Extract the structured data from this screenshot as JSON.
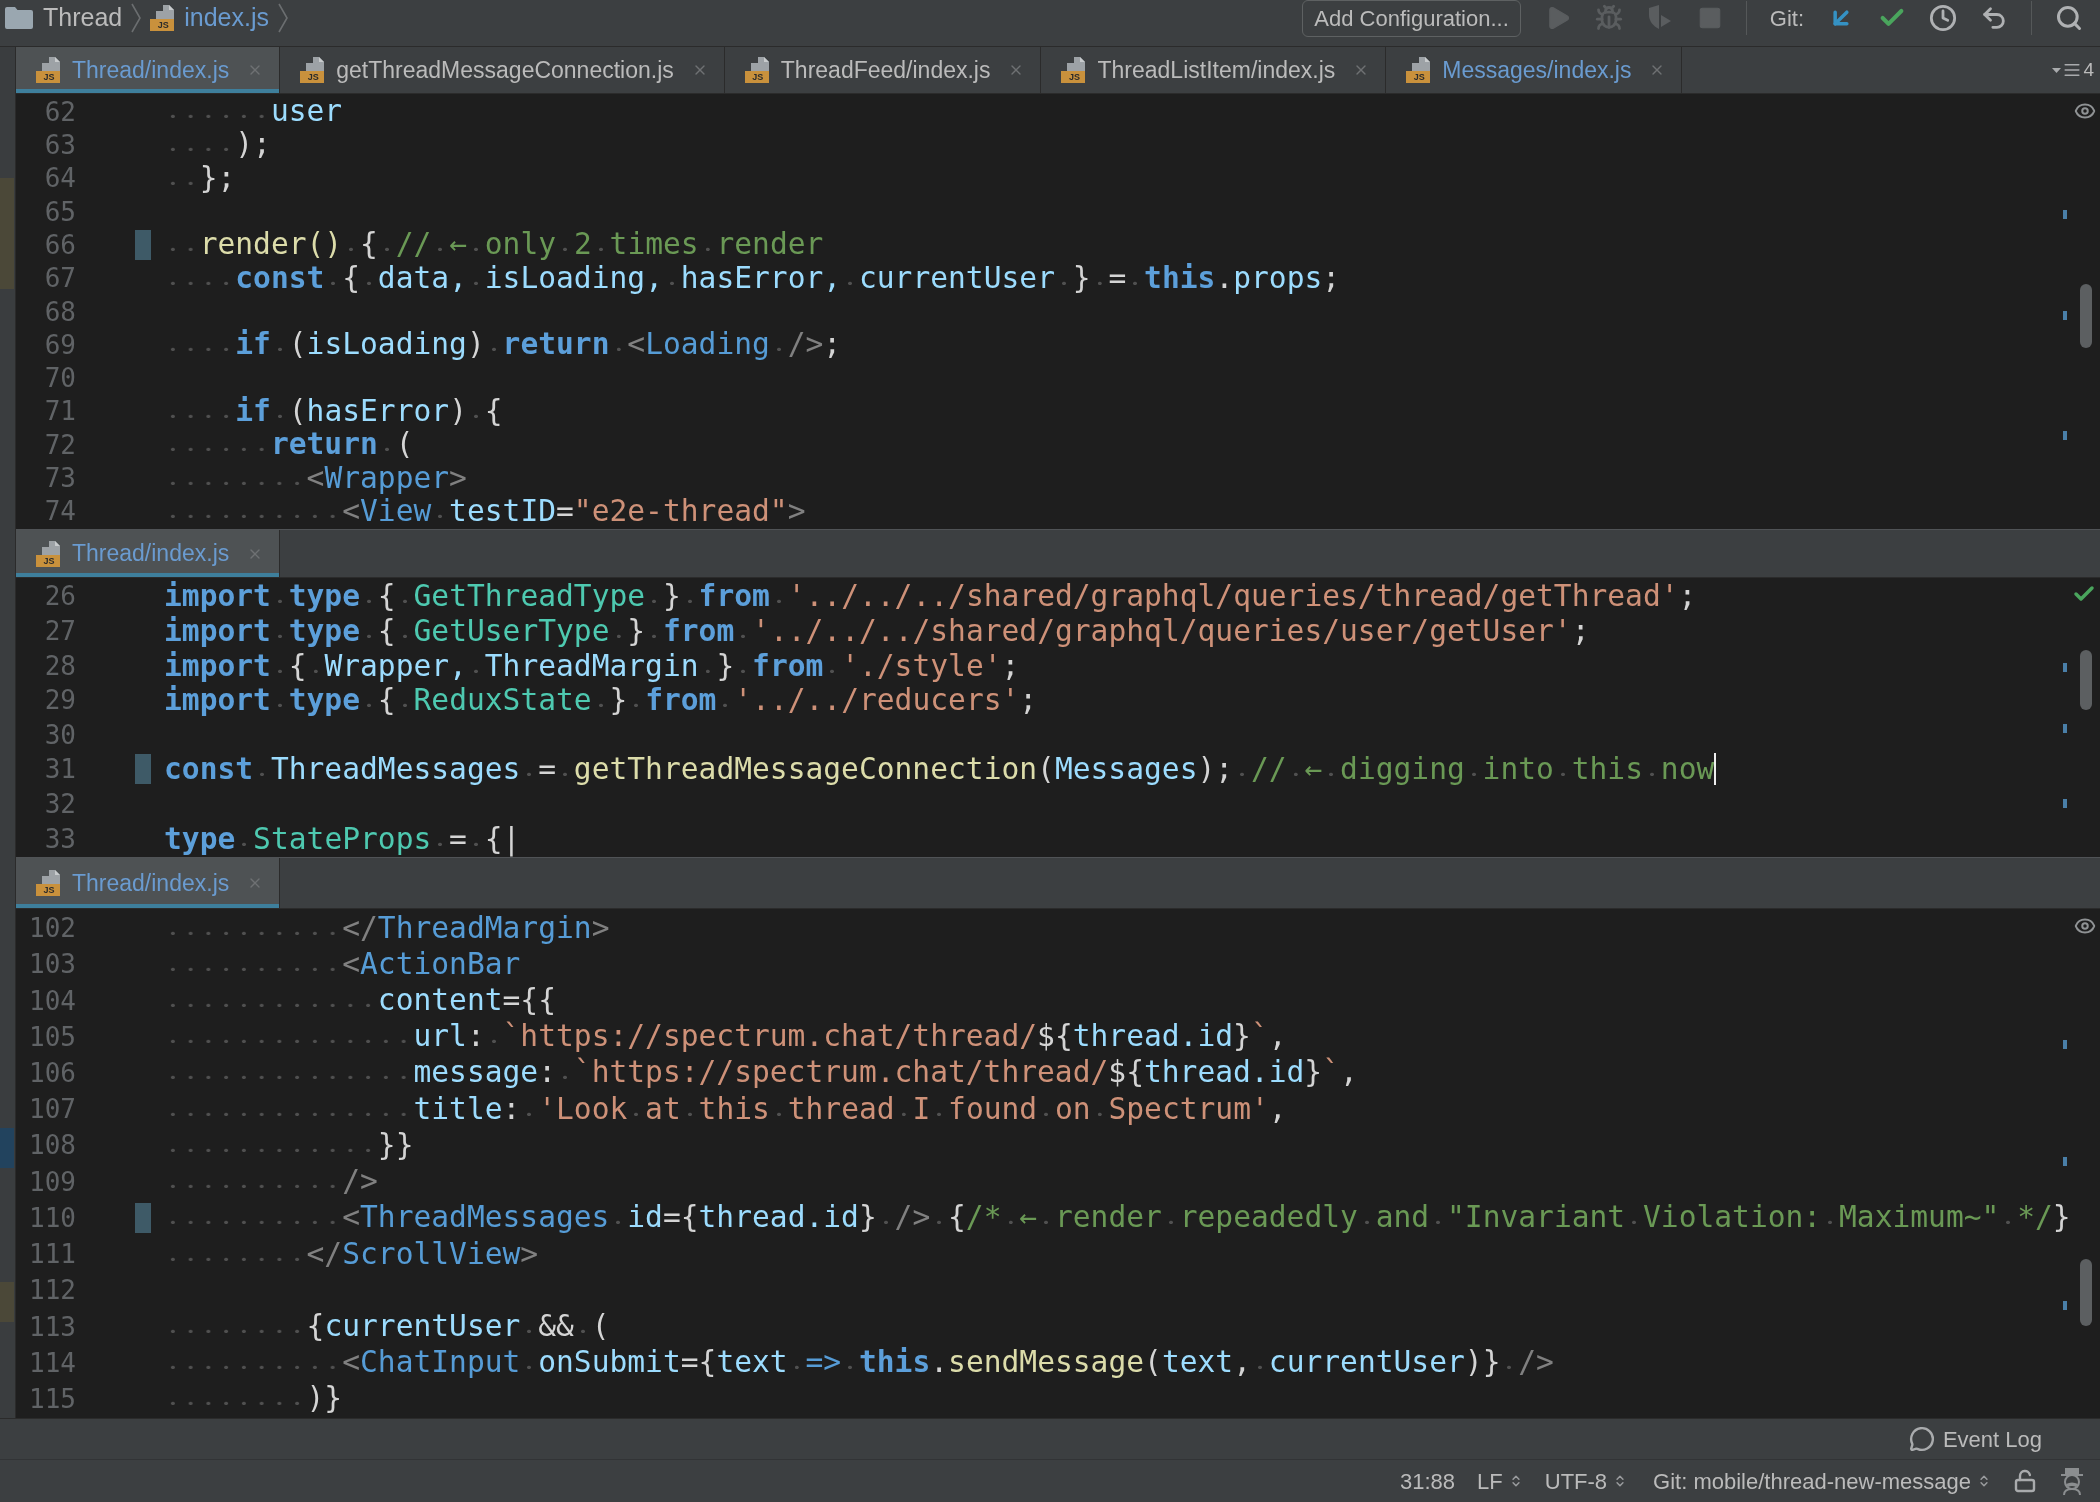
{
  "breadcrumb": [
    {
      "kind": "folder",
      "label": "Thread",
      "modified": false
    },
    {
      "kind": "file",
      "label": "index.js",
      "file_icon_text": "JS",
      "modified": true
    }
  ],
  "toolbar": {
    "config_button": "Add Configuration...",
    "run_disabled": true,
    "git_label": "Git:"
  },
  "editor": {
    "panes": [
      {
        "tabs": [
          {
            "label": "Thread/index.js",
            "file_icon_text": "JS",
            "selected": true,
            "modified": true
          },
          {
            "label": "getThreadMessageConnection.js",
            "file_icon_text": "JS",
            "selected": false,
            "modified": false
          },
          {
            "label": "ThreadFeed/index.js",
            "file_icon_text": "JS",
            "selected": false,
            "modified": false
          },
          {
            "label": "ThreadListItem/index.js",
            "file_icon_text": "JS",
            "selected": false,
            "modified": false
          },
          {
            "label": "Messages/index.js",
            "file_icon_text": "JS",
            "selected": false,
            "modified": true
          }
        ],
        "tab_list_count": "4",
        "inspection": {
          "kind": "eye"
        },
        "lines": [
          {
            "number": "62",
            "tokens": [
              {
                "kind": "var",
                "text": "      user"
              }
            ],
            "modified": false,
            "caret": false
          },
          {
            "number": "63",
            "tokens": [
              {
                "kind": "p",
                "text": "    );"
              }
            ],
            "modified": false,
            "caret": false
          },
          {
            "number": "64",
            "tokens": [
              {
                "kind": "p",
                "text": "  };"
              }
            ],
            "modified": false,
            "caret": false
          },
          {
            "number": "65",
            "modified": false,
            "caret": false
          },
          {
            "number": "66",
            "tokens": [
              {
                "kind": "fn",
                "text": "  render()"
              },
              {
                "kind": "p",
                "text": " { "
              },
              {
                "kind": "com",
                "text": "// ← only 2 times render"
              }
            ],
            "modified": true,
            "caret": false
          },
          {
            "number": "67",
            "tokens": [
              {
                "kind": "kw",
                "text": "    const"
              },
              {
                "kind": "p",
                "text": " { "
              },
              {
                "kind": "var",
                "text": "data, isLoading, hasError, currentUser"
              },
              {
                "kind": "p",
                "text": " } = "
              },
              {
                "kind": "kw",
                "text": "this"
              },
              {
                "kind": "p",
                "text": "."
              },
              {
                "kind": "var",
                "text": "props"
              },
              {
                "kind": "p",
                "text": ";"
              }
            ],
            "modified": false,
            "caret": false
          },
          {
            "number": "68",
            "modified": false,
            "caret": false
          },
          {
            "number": "69",
            "tokens": [
              {
                "kind": "kw",
                "text": "    if"
              },
              {
                "kind": "p",
                "text": " ("
              },
              {
                "kind": "var",
                "text": "isLoading"
              },
              {
                "kind": "p",
                "text": ") "
              },
              {
                "kind": "kw",
                "text": "return "
              },
              {
                "kind": "br",
                "text": "<"
              },
              {
                "kind": "tag",
                "text": "Loading"
              },
              {
                "kind": "br",
                "text": " />"
              },
              {
                "kind": "p",
                "text": ";"
              }
            ],
            "modified": false,
            "caret": false
          },
          {
            "number": "70",
            "modified": false,
            "caret": false
          },
          {
            "number": "71",
            "tokens": [
              {
                "kind": "kw",
                "text": "    if"
              },
              {
                "kind": "p",
                "text": " ("
              },
              {
                "kind": "var",
                "text": "hasError"
              },
              {
                "kind": "p",
                "text": ") {"
              }
            ],
            "modified": false,
            "caret": false
          },
          {
            "number": "72",
            "tokens": [
              {
                "kind": "kw",
                "text": "      return"
              },
              {
                "kind": "p",
                "text": " ("
              }
            ],
            "modified": false,
            "caret": false
          },
          {
            "number": "73",
            "tokens": [
              {
                "kind": "br",
                "text": "        <"
              },
              {
                "kind": "tag",
                "text": "Wrapper"
              },
              {
                "kind": "br",
                "text": ">"
              }
            ],
            "modified": false,
            "caret": false
          },
          {
            "number": "74",
            "tokens": [
              {
                "kind": "br",
                "text": "          <"
              },
              {
                "kind": "tag",
                "text": "View "
              },
              {
                "kind": "var",
                "text": "testID"
              },
              {
                "kind": "p",
                "text": "="
              },
              {
                "kind": "str",
                "text": "\"e2e-thread\""
              },
              {
                "kind": "br",
                "text": ">"
              }
            ],
            "modified": false,
            "caret": false
          }
        ]
      },
      {
        "tabs": [
          {
            "label": "Thread/index.js",
            "file_icon_text": "JS",
            "selected": true,
            "modified": true
          }
        ],
        "inspection": {
          "kind": "check"
        },
        "lines": [
          {
            "number": "26",
            "tokens": [
              {
                "kind": "kw",
                "text": "import type"
              },
              {
                "kind": "p",
                "text": " { "
              },
              {
                "kind": "type",
                "text": "GetThreadType"
              },
              {
                "kind": "p",
                "text": " } "
              },
              {
                "kind": "kw",
                "text": "from "
              },
              {
                "kind": "str",
                "text": "'../../../shared/graphql/queries/thread/getThread'"
              },
              {
                "kind": "p",
                "text": ";"
              }
            ],
            "modified": false,
            "caret": false
          },
          {
            "number": "27",
            "tokens": [
              {
                "kind": "kw",
                "text": "import type"
              },
              {
                "kind": "p",
                "text": " { "
              },
              {
                "kind": "type",
                "text": "GetUserType"
              },
              {
                "kind": "p",
                "text": " } "
              },
              {
                "kind": "kw",
                "text": "from "
              },
              {
                "kind": "str",
                "text": "'../../../shared/graphql/queries/user/getUser'"
              },
              {
                "kind": "p",
                "text": ";"
              }
            ],
            "modified": false,
            "caret": false
          },
          {
            "number": "28",
            "tokens": [
              {
                "kind": "kw",
                "text": "import"
              },
              {
                "kind": "p",
                "text": " { "
              },
              {
                "kind": "var",
                "text": "Wrapper, ThreadMargin"
              },
              {
                "kind": "p",
                "text": " } "
              },
              {
                "kind": "kw",
                "text": "from "
              },
              {
                "kind": "str",
                "text": "'./style'"
              },
              {
                "kind": "p",
                "text": ";"
              }
            ],
            "modified": false,
            "caret": false
          },
          {
            "number": "29",
            "tokens": [
              {
                "kind": "kw",
                "text": "import type"
              },
              {
                "kind": "p",
                "text": " { "
              },
              {
                "kind": "type",
                "text": "ReduxState"
              },
              {
                "kind": "p",
                "text": " } "
              },
              {
                "kind": "kw",
                "text": "from "
              },
              {
                "kind": "str",
                "text": "'../../reducers'"
              },
              {
                "kind": "p",
                "text": ";"
              }
            ],
            "modified": false,
            "caret": false
          },
          {
            "number": "30",
            "modified": false,
            "caret": false
          },
          {
            "number": "31",
            "tokens": [
              {
                "kind": "kw",
                "text": "const "
              },
              {
                "kind": "var",
                "text": "ThreadMessages"
              },
              {
                "kind": "p",
                "text": " = "
              },
              {
                "kind": "fn",
                "text": "getThreadMessageConnection"
              },
              {
                "kind": "p",
                "text": "("
              },
              {
                "kind": "var",
                "text": "Messages"
              },
              {
                "kind": "p",
                "text": "); "
              },
              {
                "kind": "com",
                "text": "// ← digging into this now"
              }
            ],
            "modified": true,
            "caret": true
          },
          {
            "number": "32",
            "modified": false,
            "caret": false
          },
          {
            "number": "33",
            "tokens": [
              {
                "kind": "kw",
                "text": "type "
              },
              {
                "kind": "type",
                "text": "StateProps"
              },
              {
                "kind": "p",
                "text": " = {|"
              }
            ],
            "modified": false,
            "caret": false
          }
        ]
      },
      {
        "tabs": [
          {
            "label": "Thread/index.js",
            "file_icon_text": "JS",
            "selected": true,
            "modified": true
          }
        ],
        "inspection": {
          "kind": "eye"
        },
        "lines": [
          {
            "number": "102",
            "tokens": [
              {
                "kind": "br",
                "text": "          </"
              },
              {
                "kind": "tag",
                "text": "ThreadMargin"
              },
              {
                "kind": "br",
                "text": ">"
              }
            ],
            "modified": false,
            "caret": false
          },
          {
            "number": "103",
            "tokens": [
              {
                "kind": "br",
                "text": "          <"
              },
              {
                "kind": "tag",
                "text": "ActionBar"
              }
            ],
            "modified": false,
            "caret": false
          },
          {
            "number": "104",
            "tokens": [
              {
                "kind": "var",
                "text": "            content"
              },
              {
                "kind": "p",
                "text": "={{"
              }
            ],
            "modified": false,
            "caret": false
          },
          {
            "number": "105",
            "tokens": [
              {
                "kind": "var",
                "text": "              url"
              },
              {
                "kind": "p",
                "text": ": "
              },
              {
                "kind": "str",
                "text": "`https://spectrum.chat/thread/"
              },
              {
                "kind": "p",
                "text": "${"
              },
              {
                "kind": "var",
                "text": "thread.id"
              },
              {
                "kind": "p",
                "text": "}"
              },
              {
                "kind": "str",
                "text": "`"
              },
              {
                "kind": "p",
                "text": ","
              }
            ],
            "modified": false,
            "caret": false
          },
          {
            "number": "106",
            "tokens": [
              {
                "kind": "var",
                "text": "              message"
              },
              {
                "kind": "p",
                "text": ": "
              },
              {
                "kind": "str",
                "text": "`https://spectrum.chat/thread/"
              },
              {
                "kind": "p",
                "text": "${"
              },
              {
                "kind": "var",
                "text": "thread.id"
              },
              {
                "kind": "p",
                "text": "}"
              },
              {
                "kind": "str",
                "text": "`"
              },
              {
                "kind": "p",
                "text": ","
              }
            ],
            "modified": false,
            "caret": false
          },
          {
            "number": "107",
            "tokens": [
              {
                "kind": "var",
                "text": "              title"
              },
              {
                "kind": "p",
                "text": ": "
              },
              {
                "kind": "str",
                "text": "'Look at this thread I found on Spectrum'"
              },
              {
                "kind": "p",
                "text": ","
              }
            ],
            "modified": false,
            "caret": false
          },
          {
            "number": "108",
            "tokens": [
              {
                "kind": "p",
                "text": "            }}"
              }
            ],
            "modified": false,
            "caret": false
          },
          {
            "number": "109",
            "tokens": [
              {
                "kind": "br",
                "text": "          />"
              }
            ],
            "modified": false,
            "caret": false
          },
          {
            "number": "110",
            "tokens": [
              {
                "kind": "br",
                "text": "          <"
              },
              {
                "kind": "tag",
                "text": "ThreadMessages "
              },
              {
                "kind": "var",
                "text": "id"
              },
              {
                "kind": "p",
                "text": "={"
              },
              {
                "kind": "var",
                "text": "thread.id"
              },
              {
                "kind": "p",
                "text": "} "
              },
              {
                "kind": "br",
                "text": "/>"
              },
              {
                "kind": "p",
                "text": " {"
              },
              {
                "kind": "com",
                "text": "/* ← render repeadedly and \"Invariant Violation: Maximum~\" */"
              },
              {
                "kind": "p",
                "text": "}"
              }
            ],
            "modified": true,
            "caret": false
          },
          {
            "number": "111",
            "tokens": [
              {
                "kind": "br",
                "text": "        </"
              },
              {
                "kind": "tag",
                "text": "ScrollView"
              },
              {
                "kind": "br",
                "text": ">"
              }
            ],
            "modified": false,
            "caret": false
          },
          {
            "number": "112",
            "modified": false,
            "caret": false
          },
          {
            "number": "113",
            "tokens": [
              {
                "kind": "p",
                "text": "        {"
              },
              {
                "kind": "var",
                "text": "currentUser"
              },
              {
                "kind": "p",
                "text": " && ("
              }
            ],
            "modified": false,
            "caret": false
          },
          {
            "number": "114",
            "tokens": [
              {
                "kind": "br",
                "text": "          <"
              },
              {
                "kind": "tag",
                "text": "ChatInput "
              },
              {
                "kind": "var",
                "text": "onSubmit"
              },
              {
                "kind": "p",
                "text": "={"
              },
              {
                "kind": "var",
                "text": "text "
              },
              {
                "kind": "tag",
                "text": "=> "
              },
              {
                "kind": "kw",
                "text": "this"
              },
              {
                "kind": "p",
                "text": "."
              },
              {
                "kind": "fn",
                "text": "sendMessage"
              },
              {
                "kind": "p",
                "text": "("
              },
              {
                "kind": "var",
                "text": "text"
              },
              {
                "kind": "p",
                "text": ", "
              },
              {
                "kind": "var",
                "text": "currentUser"
              },
              {
                "kind": "p",
                "text": ")} "
              },
              {
                "kind": "br",
                "text": "/>"
              }
            ],
            "modified": false,
            "caret": false
          },
          {
            "number": "115",
            "tokens": [
              {
                "kind": "p",
                "text": "        )}"
              }
            ],
            "modified": false,
            "caret": false
          }
        ]
      }
    ]
  },
  "tool_window_bar": {
    "event_log": "Event Log"
  },
  "status_bar": {
    "position": "31:88",
    "line_separator": "LF",
    "encoding": "UTF-8",
    "vcs_branch": "Git: mobile/thread-new-message"
  }
}
